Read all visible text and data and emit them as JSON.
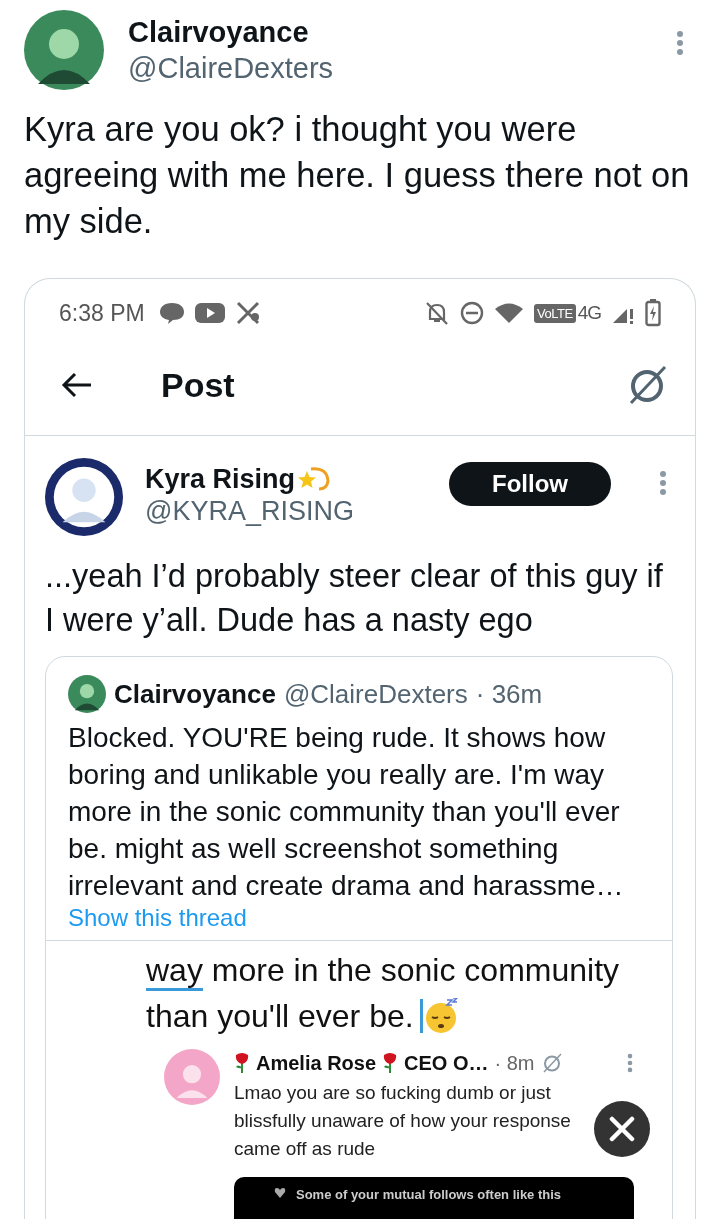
{
  "tweet": {
    "author": {
      "name": "Clairvoyance",
      "handle": "@ClaireDexters"
    },
    "text": "Kyra are you ok? i thought you were agreeing with me here. I guess there not on my side."
  },
  "screenshot": {
    "status_bar": {
      "time": "6:38 PM",
      "network": "VoLTE",
      "generation": "4G"
    },
    "nav": {
      "title": "Post"
    },
    "post": {
      "author": {
        "name": "Kyra Rising",
        "handle": "@KYRA_RISING"
      },
      "follow_button": "Follow",
      "text": "...yeah I’d probably steer clear of this guy if I were y’all. Dude has a nasty ego"
    },
    "quote": {
      "name": "Clairvoyance",
      "handle": "@ClaireDexters",
      "time": "· 36m",
      "text": "Blocked. YOU'RE being rude. It shows how boring and unlikable you really are. I'm way more in the sonic community than you'll ever be. might as well screenshot something irrelevant and create drama and harassme…",
      "link": "Show this thread",
      "image": {
        "lines": [
          [
            {
              "text": "way",
              "underlined": true
            },
            {
              "text": " more in the sonic community",
              "underlined": false
            }
          ],
          [
            {
              "text": "than you'll ever be.",
              "underlined": false
            }
          ]
        ],
        "cursor": true,
        "reply": {
          "name": "Amelia Rose",
          "title": "CEO O…",
          "time": "· 8m",
          "text": "Lmao you are so fucking dumb or just blissfully unaware of how your response came off as rude",
          "banner": "Some of your mutual follows often like this"
        }
      }
    }
  }
}
